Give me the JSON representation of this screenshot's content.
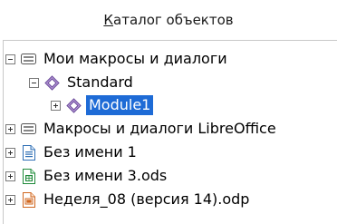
{
  "header": {
    "title_prefix": "К",
    "title_rest": "аталог объектов"
  },
  "tree": {
    "my_macros": "Мои макросы и диалоги",
    "standard": "Standard",
    "module1": "Module1",
    "lo_macros": "Макросы и диалоги LibreOffice",
    "doc1": "Без имени 1",
    "doc2": "Без имени 3.ods",
    "doc3": "Неделя_08 (версия 14).odp"
  },
  "colors": {
    "selection": "#1e6bd6"
  }
}
